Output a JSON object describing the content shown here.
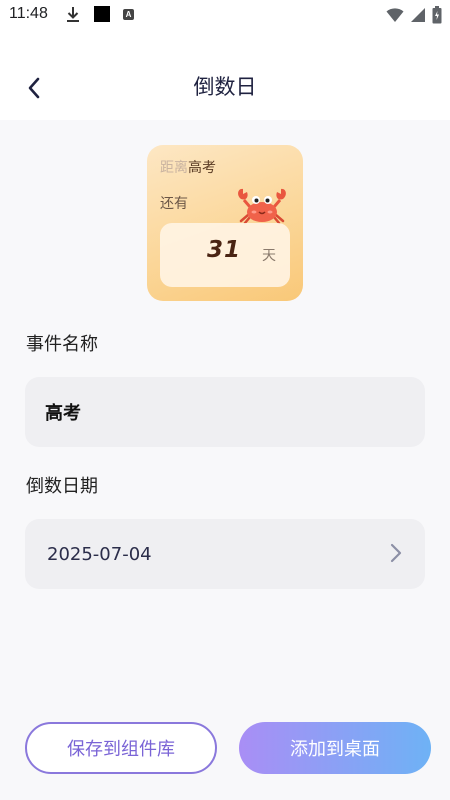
{
  "status_bar": {
    "time": "11:48",
    "a_badge": "A",
    "icons": [
      "download-icon",
      "notification-square-icon",
      "a-badge-icon",
      "wifi-icon",
      "signal-icon",
      "battery-icon"
    ]
  },
  "header": {
    "title": "倒数日"
  },
  "widget": {
    "title_prefix": "距离",
    "event_name": "高考",
    "still": "还有",
    "days": "31",
    "unit": "天",
    "mascot": "crab-icon"
  },
  "form": {
    "name_label": "事件名称",
    "name_value": "高考",
    "date_label": "倒数日期",
    "date_value": "2025-07-04"
  },
  "buttons": {
    "save": "保存到组件库",
    "add": "添加到桌面"
  },
  "colors": {
    "accent_purple": "#8a78dc",
    "gradient_start": "#a98ef5",
    "gradient_end": "#6eb2f5",
    "field_bg": "#efeff2",
    "widget_bg": "#fbd79a"
  }
}
